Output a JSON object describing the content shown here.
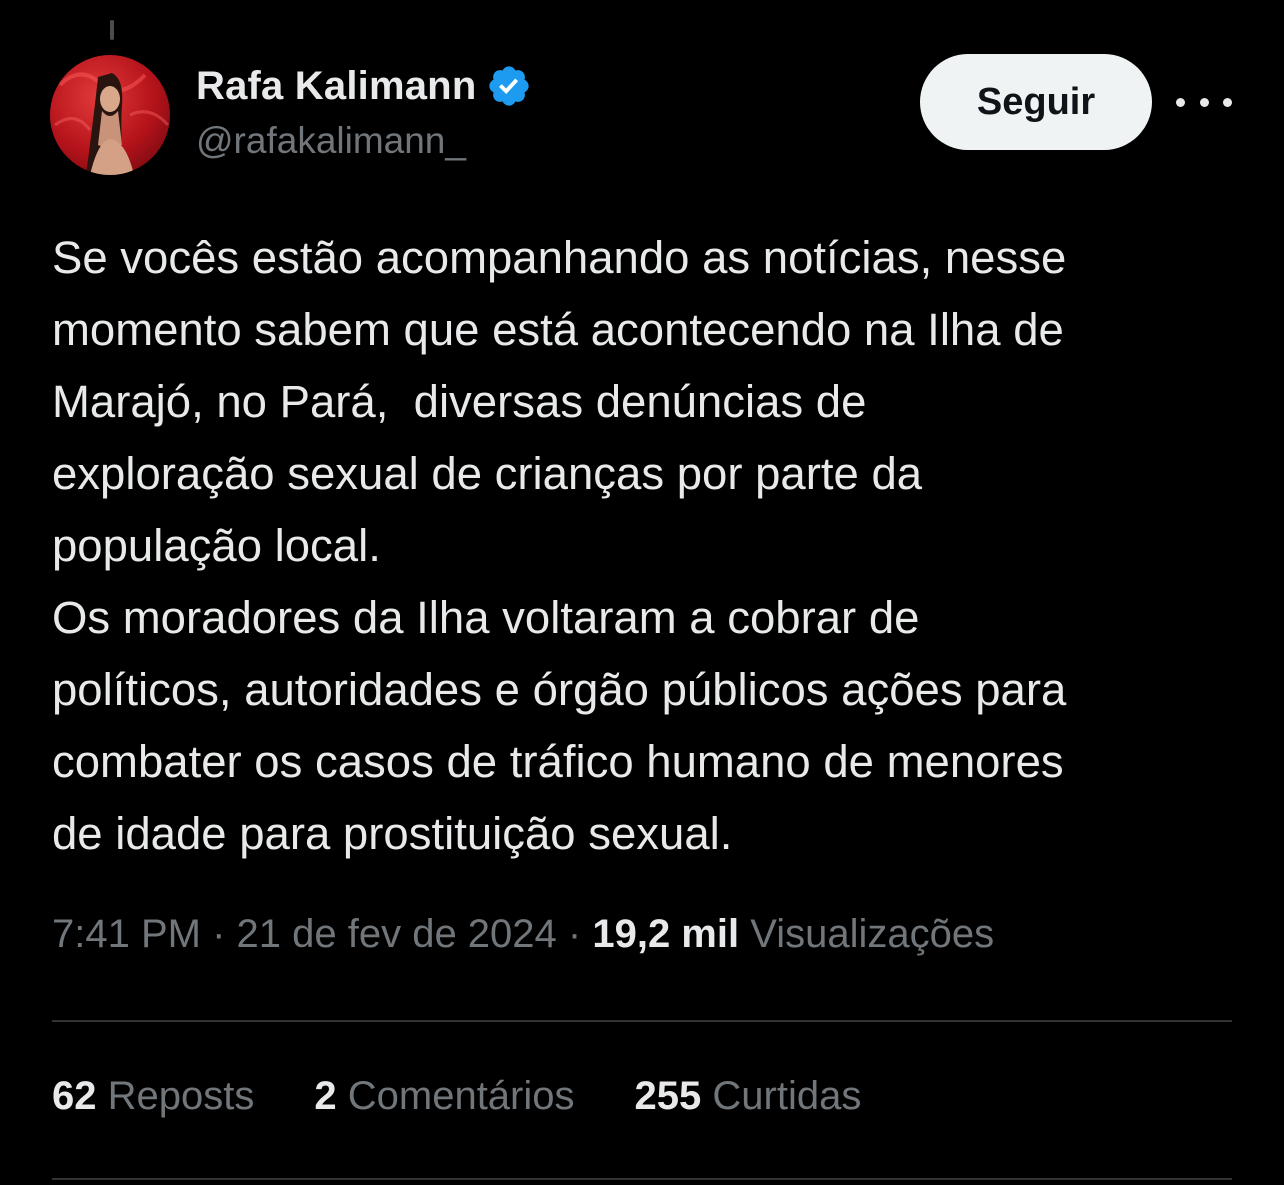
{
  "user": {
    "display_name": "Rafa Kalimann",
    "handle": "@rafakalimann_",
    "verified": true,
    "verified_icon": "verified-badge-icon",
    "verified_color": "#1d9bf0"
  },
  "actions": {
    "follow_label": "Seguir",
    "more_icon": "more-horizontal-icon"
  },
  "tweet": {
    "text": "Se vocês estão acompanhando as notícias, nesse\nmomento sabem que está acontecendo na Ilha de\nMarajó, no Pará,  diversas denúncias de\nexploração sexual de crianças por parte da\npopulação local.\nOs moradores da Ilha voltaram a cobrar de\npolíticos, autoridades e órgão públicos ações para\ncombater os casos de tráfico humano de menores\nde idade para prostituição sexual.",
    "time": "7:41 PM",
    "separator": " · ",
    "date": "21 de fev de 2024",
    "views_count": "19,2 mil",
    "views_label": "Visualizações"
  },
  "stats": {
    "reposts_count": "62",
    "reposts_label": "Reposts",
    "comments_count": "2",
    "comments_label": "Comentários",
    "likes_count": "255",
    "likes_label": "Curtidas"
  },
  "colors": {
    "background": "#000000",
    "text_primary": "#e7e9ea",
    "text_secondary": "#71767b",
    "divider": "#2f3336",
    "avatar_bg": "#b3121a"
  }
}
